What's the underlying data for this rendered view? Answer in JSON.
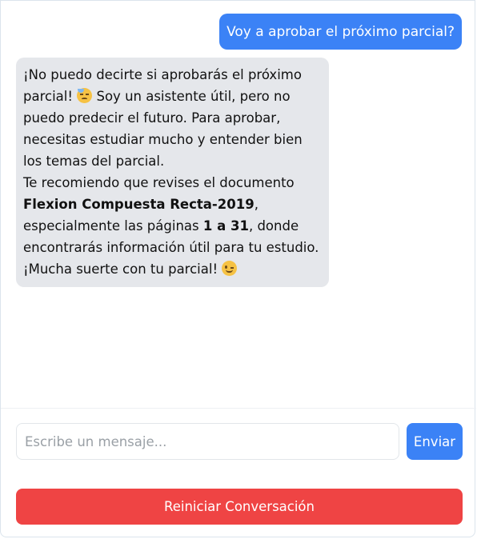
{
  "conversation": {
    "user_message": "Voy a aprobar el próximo parcial?",
    "bot_message": {
      "part1": "¡No puedo decirte si aprobarás el próximo parcial!",
      "emoji1": "downcast-face-with-sweat",
      "part2": "Soy un asistente útil, pero no puedo predecir el futuro. Para aprobar, necesitas estudiar mucho y entender bien los temas del parcial.",
      "part3": "Te recomiendo que revises el documento",
      "document_name": "Flexion Compuesta Recta-2019",
      "part4": ",",
      "part5": "especialmente las páginas",
      "pages": "1 a 31",
      "part6": ", donde encontrarás información útil para tu estudio. ¡Mucha suerte con tu parcial!",
      "emoji2": "winking-face"
    }
  },
  "composer": {
    "placeholder": "Escribe un mensaje...",
    "value": "",
    "send_label": "Enviar"
  },
  "actions": {
    "reset_label": "Reiniciar Conversación"
  },
  "colors": {
    "user_bubble": "#3b82f6",
    "bot_bubble": "#e5e7eb",
    "send_button": "#3b82f6",
    "reset_button": "#ef4444"
  }
}
